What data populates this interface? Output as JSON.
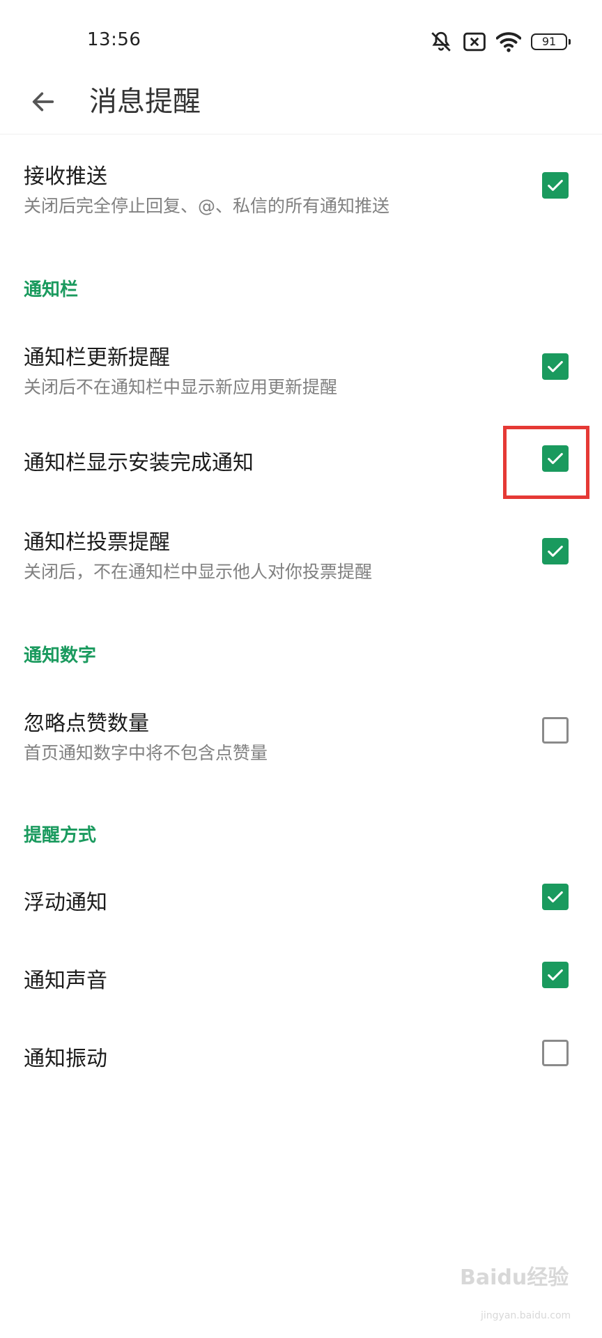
{
  "status_bar": {
    "time": "13:56",
    "battery": "91",
    "icons": [
      "mute-icon",
      "no-sim-icon",
      "wifi-icon",
      "battery-icon"
    ]
  },
  "header": {
    "title": "消息提醒",
    "back_icon": "arrow-left-icon"
  },
  "settings": {
    "receive_push": {
      "title": "接收推送",
      "subtitle": "关闭后完全停止回复、@、私信的所有通知推送",
      "checked": true
    },
    "section_notification_bar": "通知栏",
    "update_reminder": {
      "title": "通知栏更新提醒",
      "subtitle": "关闭后不在通知栏中显示新应用更新提醒",
      "checked": true
    },
    "install_complete": {
      "title": "通知栏显示安装完成通知",
      "checked": true
    },
    "vote_reminder": {
      "title": "通知栏投票提醒",
      "subtitle": "关闭后，不在通知栏中显示他人对你投票提醒",
      "checked": true
    },
    "section_notification_count": "通知数字",
    "ignore_likes": {
      "title": "忽略点赞数量",
      "subtitle": "首页通知数字中将不包含点赞量",
      "checked": false
    },
    "section_reminder_method": "提醒方式",
    "floating_notification": {
      "title": "浮动通知",
      "checked": true
    },
    "notification_sound": {
      "title": "通知声音",
      "checked": true
    },
    "notification_vibration": {
      "title": "通知振动",
      "checked": false
    }
  },
  "colors": {
    "accent": "#1a9a5e",
    "highlight": "#e53935"
  },
  "watermark": {
    "brand": "Baidu经验",
    "url": "jingyan.baidu.com"
  }
}
